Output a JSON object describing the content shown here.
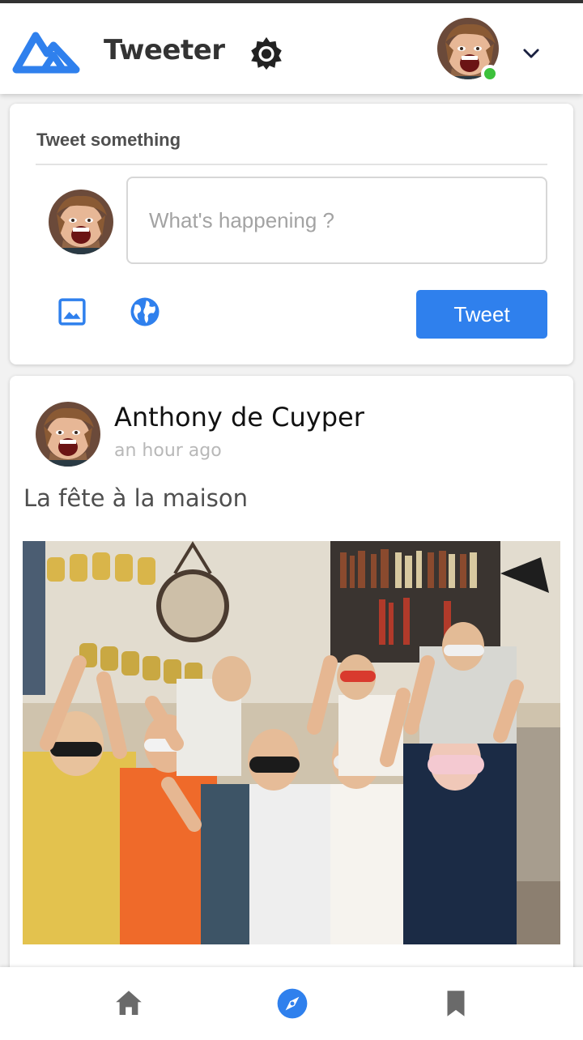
{
  "header": {
    "app_title": "Tweeter",
    "logo_icon": "mountain-logo",
    "theme_icon": "brightness-icon",
    "user_menu_icon": "chevron-down-icon",
    "online_status_color": "#3cc13b"
  },
  "compose": {
    "label": "Tweet something",
    "placeholder": "What's happening ?",
    "value": "",
    "image_icon": "image-icon",
    "visibility_icon": "globe-icon",
    "submit_label": "Tweet",
    "accent_color": "#2f80ed"
  },
  "post": {
    "author": "Anthony de Cuyper",
    "time": "an hour ago",
    "text": "La fête à la maison",
    "has_image": true
  },
  "bottom_nav": {
    "items": [
      {
        "icon": "home-icon",
        "active": false
      },
      {
        "icon": "explore-icon",
        "active": true
      },
      {
        "icon": "bookmark-icon",
        "active": false
      }
    ]
  }
}
